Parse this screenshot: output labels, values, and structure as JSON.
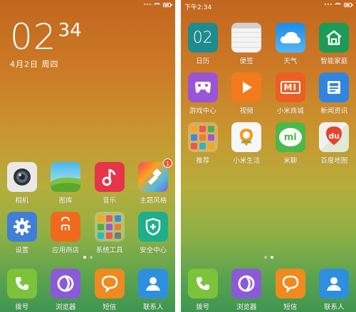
{
  "left": {
    "status": {
      "time": ""
    },
    "clock": {
      "hour": "02",
      "minute": "34",
      "date": "4月2日 周四"
    },
    "apps": [
      {
        "label": "相机",
        "icon": "camera-icon"
      },
      {
        "label": "图库",
        "icon": "gallery-icon"
      },
      {
        "label": "音乐",
        "icon": "music-icon"
      },
      {
        "label": "主题风格",
        "icon": "theme-icon",
        "badge": "1"
      },
      {
        "label": "设置",
        "icon": "settings-gear-icon"
      },
      {
        "label": "应用商店",
        "icon": "app-store-icon"
      },
      {
        "label": "系统工具",
        "icon": "tools-folder-icon"
      },
      {
        "label": "安全中心",
        "icon": "security-shield-icon"
      }
    ],
    "dock": [
      {
        "label": "拨号",
        "icon": "phone-icon"
      },
      {
        "label": "浏览器",
        "icon": "browser-icon"
      },
      {
        "label": "短信",
        "icon": "message-icon"
      },
      {
        "label": "联系人",
        "icon": "contacts-icon"
      }
    ]
  },
  "right": {
    "status": {
      "time": "下午2:34"
    },
    "calendar_day": "02",
    "apps": [
      {
        "label": "日历",
        "icon": "calendar-icon"
      },
      {
        "label": "便签",
        "icon": "notes-icon"
      },
      {
        "label": "天气",
        "icon": "weather-icon"
      },
      {
        "label": "智能家庭",
        "icon": "smart-home-icon"
      },
      {
        "label": "游戏中心",
        "icon": "game-center-icon"
      },
      {
        "label": "视频",
        "icon": "video-icon"
      },
      {
        "label": "小米商城",
        "icon": "mi-store-icon",
        "logo": "mi"
      },
      {
        "label": "新闻资讯",
        "icon": "news-icon"
      },
      {
        "label": "推荐",
        "icon": "recommend-folder-icon"
      },
      {
        "label": "小米生活",
        "icon": "mi-life-icon"
      },
      {
        "label": "米聊",
        "icon": "mitalk-icon",
        "logo": "mi"
      },
      {
        "label": "百度地图",
        "icon": "baidu-map-icon",
        "logo": "du"
      }
    ],
    "dock": [
      {
        "label": "拨号",
        "icon": "phone-icon"
      },
      {
        "label": "浏览器",
        "icon": "browser-icon"
      },
      {
        "label": "短信",
        "icon": "message-icon"
      },
      {
        "label": "联系人",
        "icon": "contacts-icon"
      }
    ]
  },
  "colors": {
    "wallpaper_top": "#c2661f",
    "wallpaper_bottom": "#3f9651",
    "badge": "#f2512a"
  }
}
